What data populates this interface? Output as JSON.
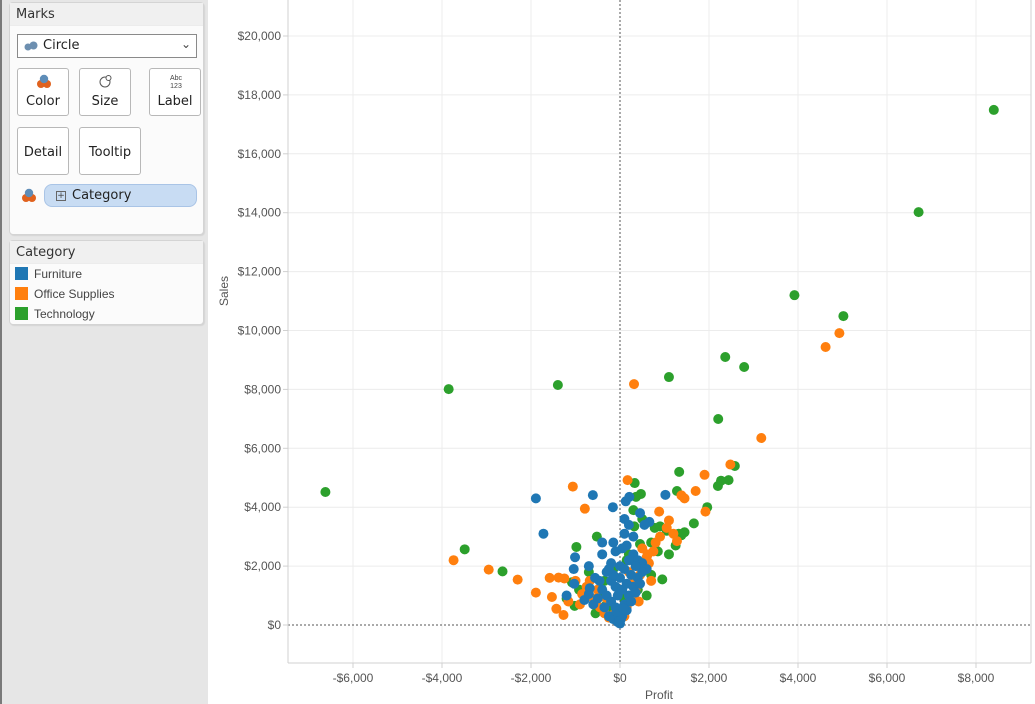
{
  "marks": {
    "title": "Marks",
    "mark_type": "Circle",
    "buttons": {
      "color": "Color",
      "size": "Size",
      "label": "Label",
      "label_icon_text": "Abc\n123",
      "detail": "Detail",
      "tooltip": "Tooltip"
    },
    "pill": {
      "field": "Category",
      "encoding": "color"
    }
  },
  "legend": {
    "title": "Category",
    "items": [
      {
        "label": "Furniture",
        "color": "#1f77b4"
      },
      {
        "label": "Office Supplies",
        "color": "#ff7f0e"
      },
      {
        "label": "Technology",
        "color": "#2ca02c"
      }
    ]
  },
  "chart_data": {
    "type": "scatter",
    "title": "",
    "xlabel": "Profit",
    "ylabel": "Sales",
    "xlim": [
      -7500,
      9250
    ],
    "ylim": [
      -1300,
      21200
    ],
    "x_ticks": [
      -6000,
      -4000,
      -2000,
      0,
      2000,
      4000,
      6000,
      8000
    ],
    "x_tick_labels": [
      "-$6,000",
      "-$4,000",
      "-$2,000",
      "$0",
      "$2,000",
      "$4,000",
      "$6,000",
      "$8,000"
    ],
    "y_ticks": [
      0,
      2000,
      4000,
      6000,
      8000,
      10000,
      12000,
      14000,
      16000,
      18000,
      20000
    ],
    "y_tick_labels": [
      "$0",
      "$2,000",
      "$4,000",
      "$6,000",
      "$8,000",
      "$10,000",
      "$12,000",
      "$14,000",
      "$16,000",
      "$18,000",
      "$20,000"
    ],
    "grid": true,
    "zero_lines": true,
    "legend_position": "left-panel",
    "series": [
      {
        "name": "Technology",
        "color": "#2ca02c",
        "points": [
          [
            8400,
            17490
          ],
          [
            6710,
            14020
          ],
          [
            3920,
            11200
          ],
          [
            5020,
            10490
          ],
          [
            2365,
            9100
          ],
          [
            2790,
            8760
          ],
          [
            1100,
            8420
          ],
          [
            -1396,
            8150
          ],
          [
            -3850,
            8010
          ],
          [
            2207,
            6995
          ],
          [
            -6620,
            4516
          ],
          [
            1330,
            5200
          ],
          [
            2580,
            5400
          ],
          [
            330,
            4820
          ],
          [
            2270,
            4900
          ],
          [
            2440,
            4920
          ],
          [
            2200,
            4720
          ],
          [
            470,
            4450
          ],
          [
            360,
            4350
          ],
          [
            1280,
            4550
          ],
          [
            1960,
            4000
          ],
          [
            1660,
            3450
          ],
          [
            -520,
            3000
          ],
          [
            1320,
            3100
          ],
          [
            1450,
            3150
          ],
          [
            1380,
            3050
          ],
          [
            900,
            3350
          ],
          [
            1050,
            3200
          ],
          [
            320,
            3350
          ],
          [
            -3490,
            2570
          ],
          [
            -2640,
            1820
          ],
          [
            -980,
            2650
          ],
          [
            -1080,
            1450
          ],
          [
            -1020,
            650
          ],
          [
            -920,
            1200
          ],
          [
            -1200,
            900
          ],
          [
            -440,
            1100
          ],
          [
            -300,
            700
          ],
          [
            700,
            1700
          ],
          [
            950,
            1550
          ],
          [
            550,
            2100
          ],
          [
            450,
            2750
          ],
          [
            700,
            2800
          ],
          [
            200,
            2400
          ],
          [
            -150,
            1900
          ],
          [
            -700,
            1800
          ],
          [
            -350,
            1500
          ],
          [
            100,
            900
          ],
          [
            250,
            1400
          ],
          [
            400,
            1200
          ],
          [
            600,
            1000
          ],
          [
            150,
            2200
          ],
          [
            850,
            2500
          ],
          [
            1100,
            2400
          ],
          [
            1250,
            2700
          ],
          [
            300,
            3900
          ],
          [
            500,
            3600
          ],
          [
            -200,
            500
          ],
          [
            -550,
            400
          ],
          [
            780,
            3300
          ]
        ]
      },
      {
        "name": "Office Supplies",
        "color": "#ff7f0e",
        "points": [
          [
            4930,
            9910
          ],
          [
            4620,
            9440
          ],
          [
            315,
            8180
          ],
          [
            3175,
            6350
          ],
          [
            2480,
            5450
          ],
          [
            1900,
            5100
          ],
          [
            1700,
            4550
          ],
          [
            1380,
            4400
          ],
          [
            1450,
            4300
          ],
          [
            1920,
            3850
          ],
          [
            170,
            4920
          ],
          [
            -1060,
            4700
          ],
          [
            -790,
            3950
          ],
          [
            880,
            3850
          ],
          [
            1100,
            3550
          ],
          [
            1200,
            3100
          ],
          [
            1280,
            2850
          ],
          [
            -3740,
            2200
          ],
          [
            -2950,
            1880
          ],
          [
            -2300,
            1540
          ],
          [
            -1890,
            1100
          ],
          [
            -1530,
            950
          ],
          [
            -1160,
            800
          ],
          [
            -1430,
            550
          ],
          [
            -1270,
            340
          ],
          [
            -1580,
            1600
          ],
          [
            -1380,
            1610
          ],
          [
            -1250,
            1580
          ],
          [
            -1000,
            1500
          ],
          [
            -750,
            1300
          ],
          [
            -600,
            900
          ],
          [
            -450,
            600
          ],
          [
            -350,
            400
          ],
          [
            -250,
            250
          ],
          [
            -100,
            200
          ],
          [
            -680,
            1500
          ],
          [
            -850,
            1050
          ],
          [
            -500,
            1200
          ],
          [
            200,
            1800
          ],
          [
            400,
            2000
          ],
          [
            600,
            2300
          ],
          [
            700,
            1500
          ],
          [
            800,
            2800
          ],
          [
            900,
            3000
          ],
          [
            500,
            2600
          ],
          [
            300,
            1000
          ],
          [
            150,
            600
          ],
          [
            100,
            300
          ],
          [
            250,
            1400
          ],
          [
            450,
            1700
          ],
          [
            650,
            2100
          ],
          [
            750,
            2500
          ],
          [
            350,
            1200
          ],
          [
            550,
            1900
          ],
          [
            -150,
            350
          ],
          [
            1050,
            3300
          ],
          [
            620,
            2400
          ],
          [
            420,
            800
          ],
          [
            -900,
            700
          ],
          [
            -300,
            900
          ]
        ]
      },
      {
        "name": "Furniture",
        "color": "#1f77b4",
        "points": [
          [
            -1890,
            4300
          ],
          [
            -610,
            4410
          ],
          [
            -1720,
            3100
          ],
          [
            -160,
            4000
          ],
          [
            130,
            4200
          ],
          [
            210,
            4350
          ],
          [
            1020,
            4420
          ],
          [
            100,
            3600
          ],
          [
            200,
            3400
          ],
          [
            450,
            3800
          ],
          [
            -400,
            2400
          ],
          [
            -1010,
            2300
          ],
          [
            -1040,
            1900
          ],
          [
            -700,
            2000
          ],
          [
            -680,
            1250
          ],
          [
            -560,
            1600
          ],
          [
            -460,
            1500
          ],
          [
            -1030,
            1400
          ],
          [
            -1200,
            1000
          ],
          [
            -800,
            850
          ],
          [
            -150,
            2800
          ],
          [
            50,
            2600
          ],
          [
            150,
            2700
          ],
          [
            300,
            2400
          ],
          [
            400,
            2200
          ],
          [
            500,
            2100
          ],
          [
            600,
            1900
          ],
          [
            100,
            3100
          ],
          [
            -100,
            2500
          ],
          [
            0,
            2000
          ],
          [
            -300,
            1800
          ],
          [
            -200,
            1500
          ],
          [
            -400,
            1200
          ],
          [
            -300,
            1000
          ],
          [
            -200,
            800
          ],
          [
            -100,
            600
          ],
          [
            0,
            400
          ],
          [
            100,
            700
          ],
          [
            200,
            1000
          ],
          [
            300,
            1300
          ],
          [
            400,
            1600
          ],
          [
            500,
            1800
          ],
          [
            -500,
            900
          ],
          [
            -350,
            600
          ],
          [
            -250,
            300
          ],
          [
            -150,
            200
          ],
          [
            -50,
            100
          ],
          [
            50,
            300
          ],
          [
            150,
            500
          ],
          [
            250,
            800
          ],
          [
            350,
            1100
          ],
          [
            450,
            1400
          ],
          [
            0,
            1600
          ],
          [
            -100,
            1300
          ],
          [
            100,
            1900
          ],
          [
            200,
            2200
          ],
          [
            -200,
            2100
          ],
          [
            -400,
            2800
          ],
          [
            300,
            3000
          ],
          [
            660,
            3500
          ],
          [
            550,
            3400
          ],
          [
            -600,
            700
          ],
          [
            -700,
            1050
          ],
          [
            -50,
            1000
          ],
          [
            50,
            1200
          ],
          [
            -150,
            1700
          ],
          [
            -250,
            1900
          ],
          [
            150,
            1400
          ],
          [
            250,
            1700
          ],
          [
            350,
            2000
          ],
          [
            0,
            50
          ],
          [
            -20,
            150
          ],
          [
            20,
            200
          ],
          [
            -80,
            450
          ],
          [
            80,
            550
          ]
        ]
      }
    ]
  }
}
